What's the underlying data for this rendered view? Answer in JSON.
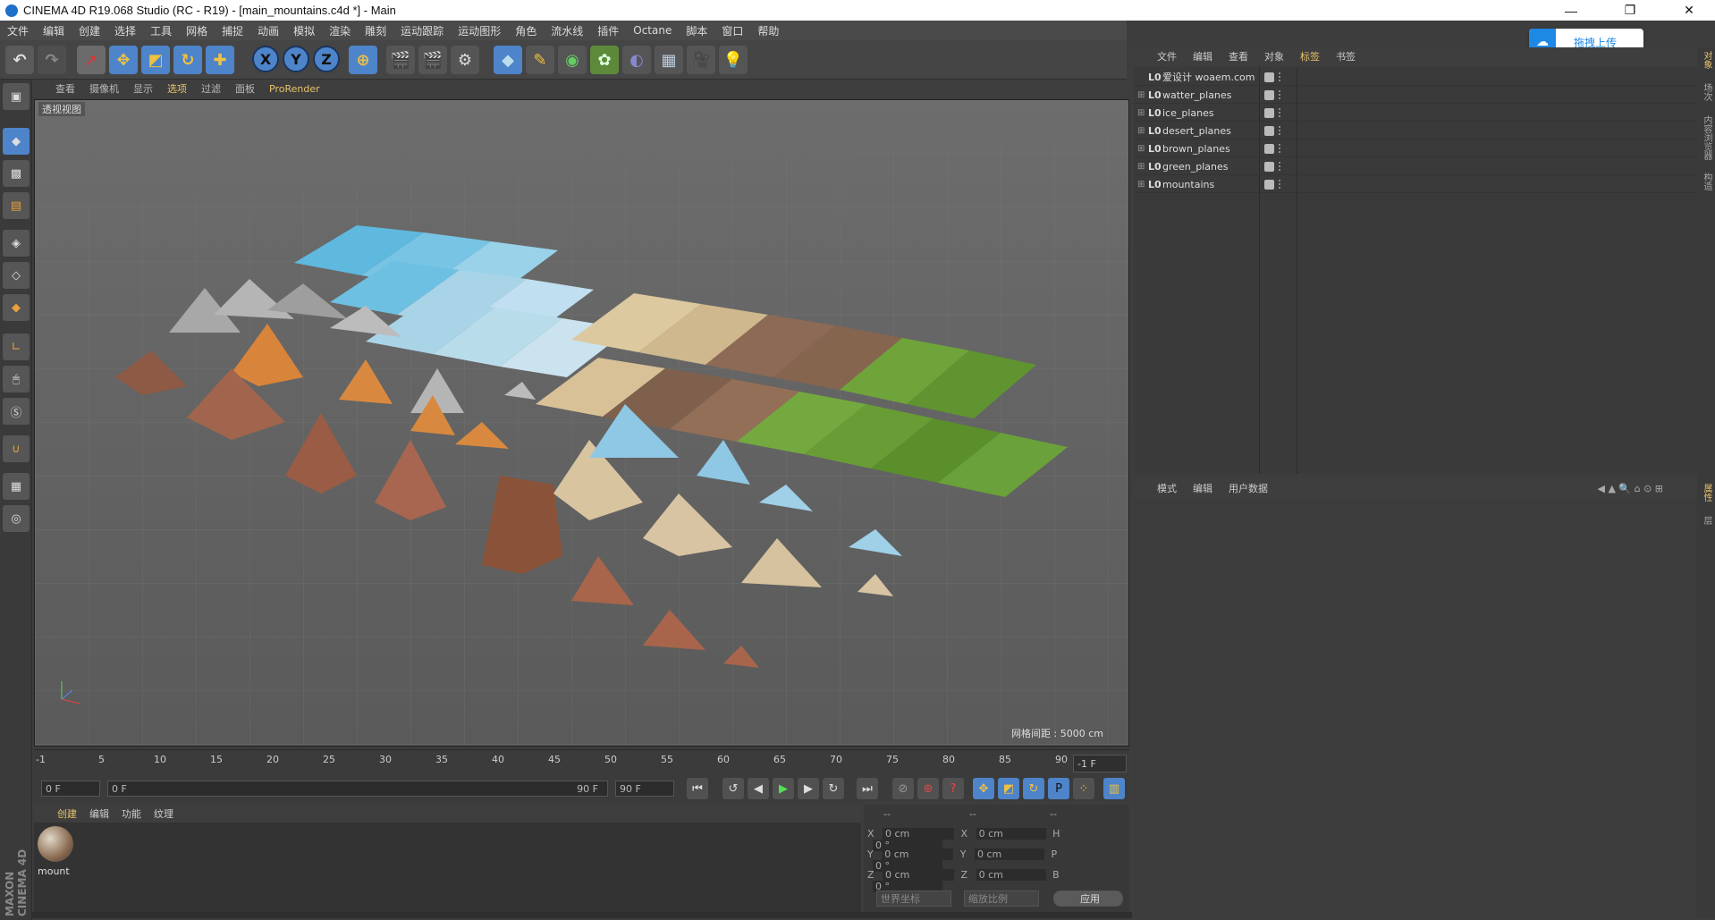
{
  "window": {
    "title": "CINEMA 4D R19.068 Studio (RC - R19) - [main_mountains.c4d *] - Main",
    "minimize": "—",
    "maximize": "❐",
    "close": "✕"
  },
  "menu": [
    "文件",
    "编辑",
    "创建",
    "选择",
    "工具",
    "网格",
    "捕捉",
    "动画",
    "模拟",
    "渲染",
    "雕刻",
    "运动跟踪",
    "运动图形",
    "角色",
    "流水线",
    "插件",
    "Octane",
    "脚本",
    "窗口",
    "帮助"
  ],
  "toolbar": {
    "axis_x": "X",
    "axis_y": "Y",
    "axis_z": "Z"
  },
  "viewport": {
    "menu": [
      "查看",
      "摄像机",
      "显示",
      "选项",
      "过滤",
      "面板",
      "ProRender"
    ],
    "view_label": "透视视图",
    "grid_label": "网格间距 : 5000 cm"
  },
  "timeline": {
    "ticks": [
      "-1",
      "5",
      "10",
      "15",
      "20",
      "25",
      "30",
      "35",
      "40",
      "45",
      "50",
      "55",
      "60",
      "65",
      "70",
      "75",
      "80",
      "85",
      "90"
    ],
    "frame_end": "-1 F",
    "current": "0 F",
    "range_start": "0 F",
    "range_end": "90 F",
    "max": "90 F"
  },
  "material_manager": {
    "menu": [
      "创建",
      "编辑",
      "功能",
      "纹理"
    ],
    "material_name": "mount"
  },
  "coords": {
    "header": [
      "--",
      "--",
      "--"
    ],
    "rows": [
      {
        "a": "X",
        "av": "0 cm",
        "b": "X",
        "bv": "0 cm",
        "c": "H",
        "cv": "0 °"
      },
      {
        "a": "Y",
        "av": "0 cm",
        "b": "Y",
        "bv": "0 cm",
        "c": "P",
        "cv": "0 °"
      },
      {
        "a": "Z",
        "av": "0 cm",
        "b": "Z",
        "bv": "0 cm",
        "c": "B",
        "cv": "0 °"
      }
    ],
    "world": "世界坐标",
    "scale": "缩放比例",
    "apply": "应用"
  },
  "object_manager": {
    "menu": [
      "文件",
      "编辑",
      "查看",
      "对象",
      "标签",
      "书签"
    ],
    "objects": [
      "爱设计 woaem.com",
      "watter_planes",
      "ice_planes",
      "desert_planes",
      "brown_planes",
      "green_planes",
      "mountains"
    ]
  },
  "attribute_manager": {
    "menu": [
      "模式",
      "编辑",
      "用户数据"
    ]
  },
  "cloud_upload": {
    "label": "拖拽上传"
  },
  "brand": "MAXON CINEMA 4D",
  "colors": {
    "accent": "#e8c36a",
    "water": "#5fb8de",
    "ice": "#a9d4e8",
    "desert": "#dcc9a0",
    "brown": "#8c6a55",
    "green": "#6fa43a"
  }
}
